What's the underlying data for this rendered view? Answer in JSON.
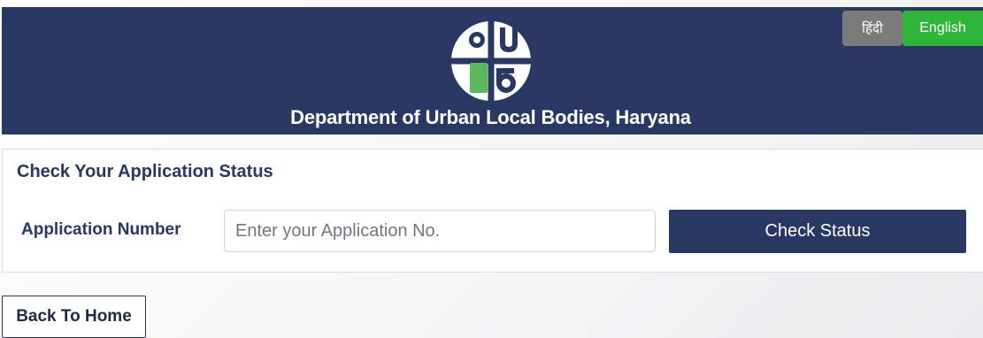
{
  "header": {
    "title": "Department of Urban Local Bodies, Haryana",
    "logo_icon": "ulb-haryana-logo-icon",
    "background_color": "#283862"
  },
  "language": {
    "hindi_label": "हिंदी",
    "english_label": "English",
    "active": "English",
    "active_color": "#2fb63a",
    "inactive_color": "#7b7b7b"
  },
  "status_form": {
    "title": "Check Your Application Status",
    "application_label": "Application Number",
    "application_value": "",
    "application_placeholder": "Enter your Application No.",
    "submit_label": "Check Status"
  },
  "footer": {
    "back_label": "Back To Home"
  }
}
